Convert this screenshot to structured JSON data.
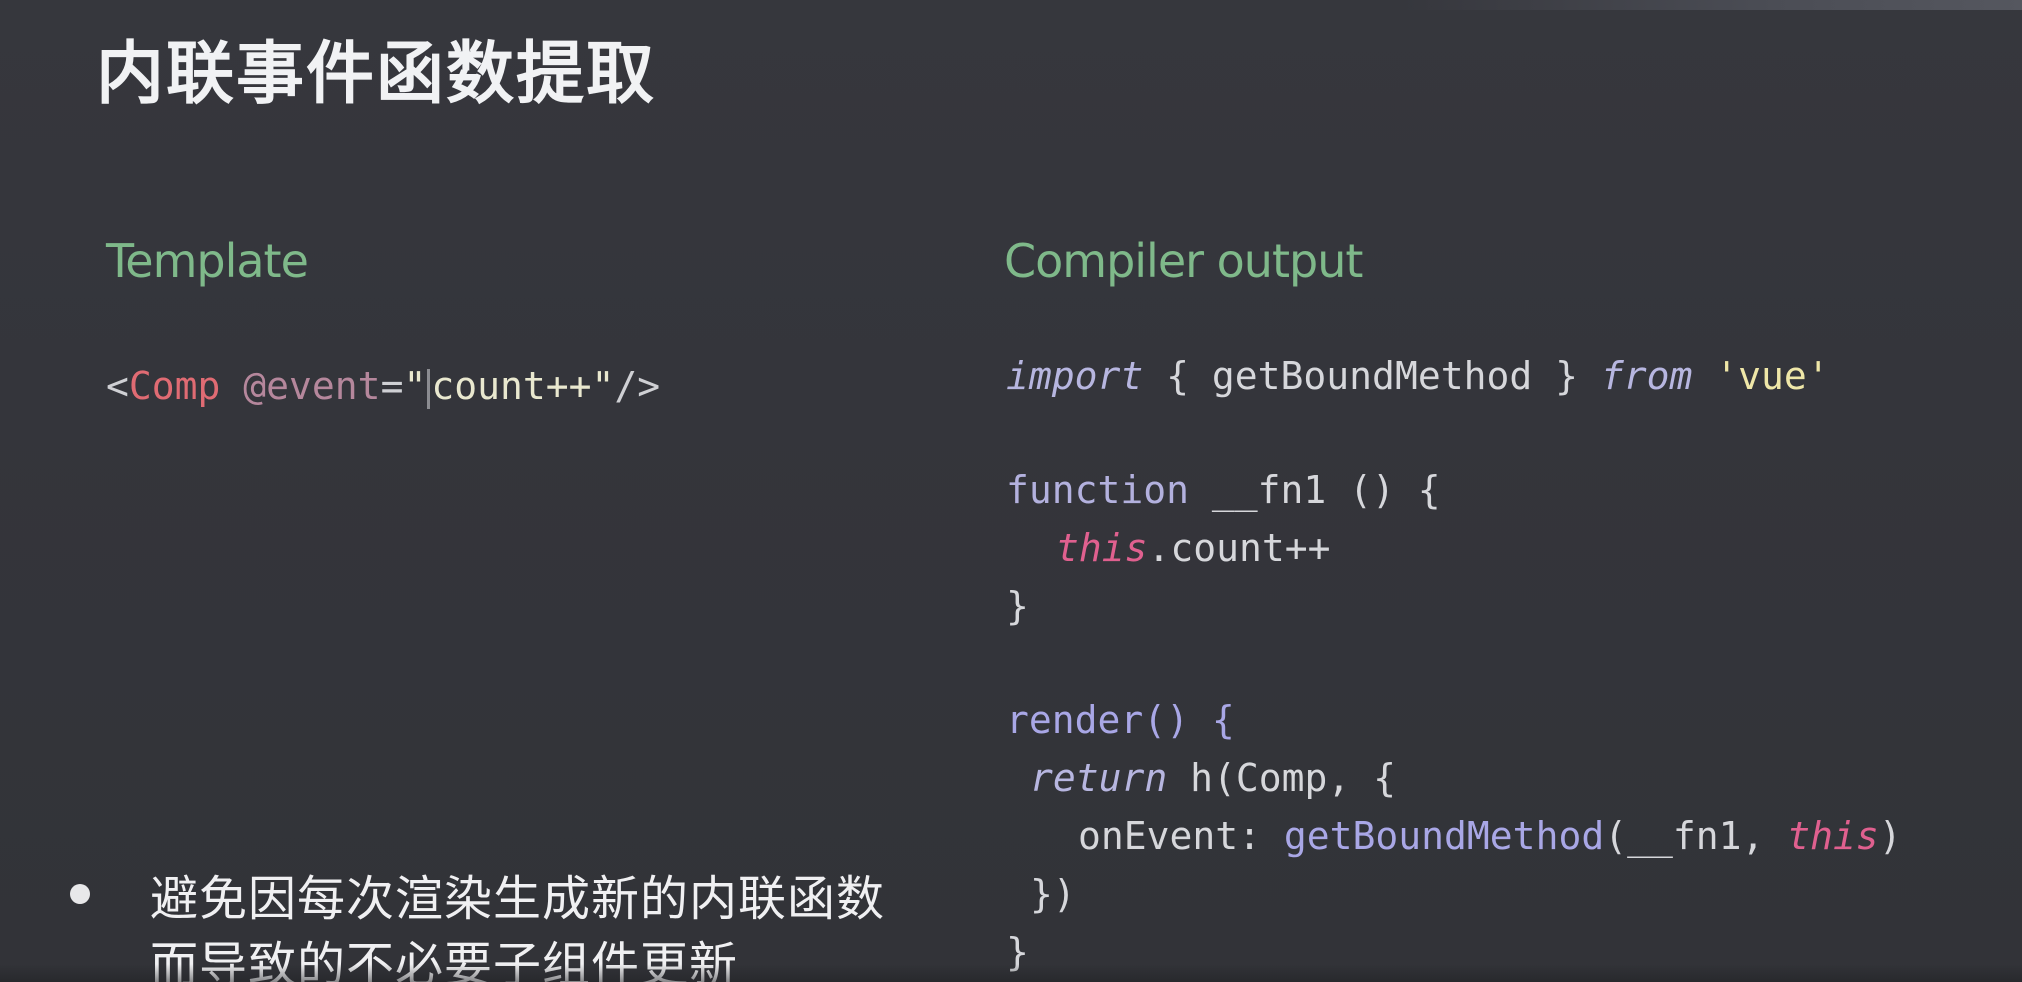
{
  "slide": {
    "title": "内联事件函数提取",
    "left_heading": "Template",
    "right_heading": "Compiler output",
    "template_code": {
      "open": "<",
      "component": "Comp",
      "attr": "@event",
      "eq": "=",
      "quote_open": "\"",
      "value": "count++\"",
      "close": "/>"
    },
    "compiler_code": {
      "l1_import": "import",
      "l1_mid": " { getBoundMethod } ",
      "l1_from": "from",
      "l1_str": " 'vue'",
      "l2_function": "function",
      "l2_rest": " __fn1 () {",
      "l3_this": "this",
      "l3_rest": ".count++",
      "l4": "}",
      "l5": "render() {",
      "l6_return": "return",
      "l6_rest": " h(Comp, {",
      "l7_key": "onEvent: ",
      "l7_call": "getBoundMethod",
      "l7_args": "(__fn1, ",
      "l7_this": "this",
      "l7_close": ")",
      "l8": "})",
      "l9": "}"
    },
    "bullet": "避免因每次渲染生成新的内联函数而导致的不必要子组件更新"
  }
}
